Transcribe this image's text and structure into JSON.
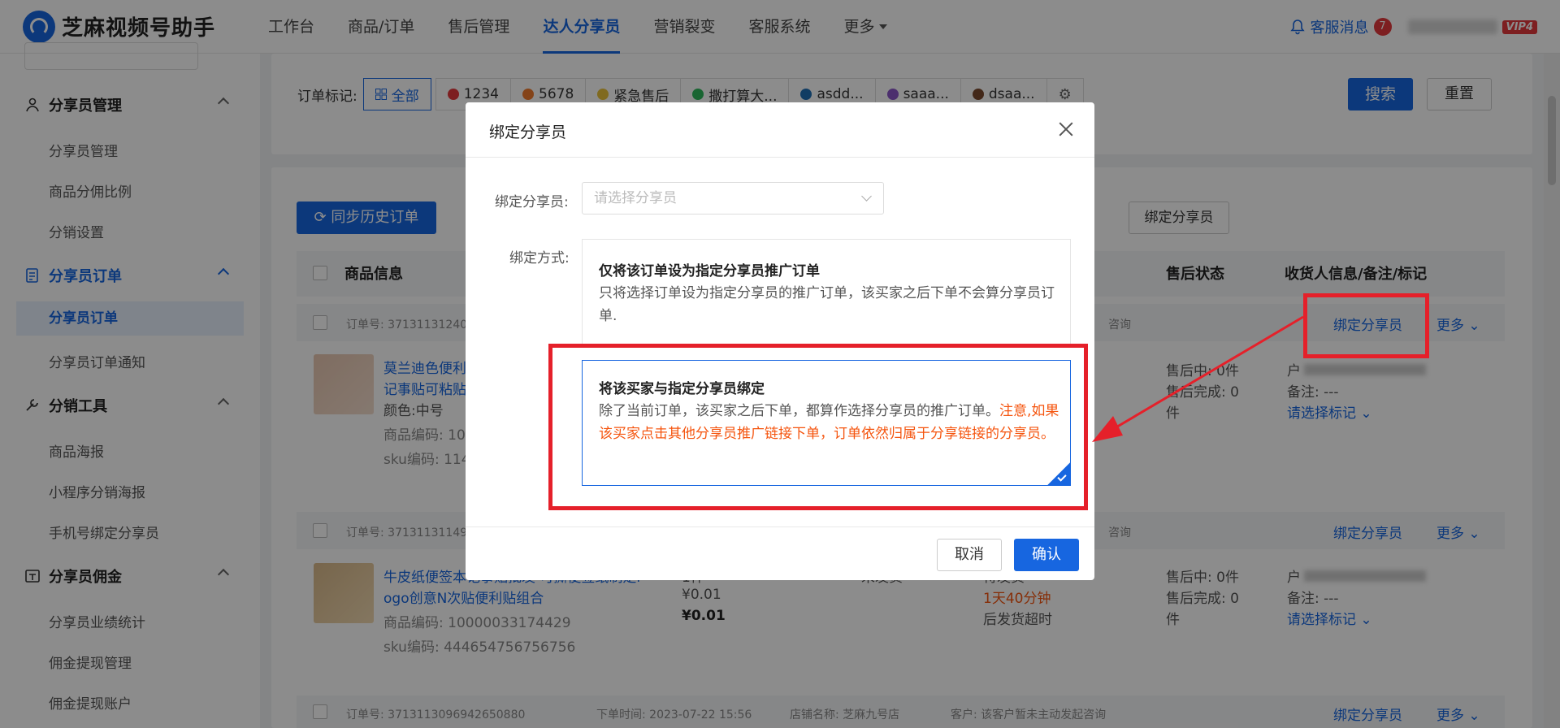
{
  "app": {
    "name": "芝麻视频号助手"
  },
  "nav": {
    "items": [
      "工作台",
      "商品/订单",
      "售后管理",
      "达人分享员",
      "营销裂变",
      "客服系统",
      "更多"
    ],
    "active_index": 3
  },
  "top_right": {
    "service_label": "客服消息",
    "unread_count": "7",
    "vip_label": "VIP4"
  },
  "sidebar": {
    "groups": [
      {
        "label": "分享员管理",
        "items": [
          "分享员管理",
          "商品分佣比例",
          "分销设置"
        ]
      },
      {
        "label": "分享员订单",
        "items": [
          "分享员订单",
          "分享员订单通知"
        ]
      },
      {
        "label": "分销工具",
        "items": [
          "商品海报",
          "小程序分销海报",
          "手机号绑定分享员"
        ]
      },
      {
        "label": "分享员佣金",
        "items": [
          "分享员业绩统计",
          "佣金提现管理",
          "佣金提现账户"
        ]
      }
    ],
    "active_item": "分享员订单"
  },
  "filters": {
    "tag_label": "订单标记:",
    "tags": [
      {
        "label": "全部",
        "color": ""
      },
      {
        "label": "1234",
        "color": "#e4393c"
      },
      {
        "label": "5678",
        "color": "#f07a2c"
      },
      {
        "label": "紧急售后",
        "color": "#e9c23b"
      },
      {
        "label": "撒打算大...",
        "color": "#2eb85c"
      },
      {
        "label": "asdd...",
        "color": "#1f6fb5"
      },
      {
        "label": "saaa...",
        "color": "#8a56c9"
      },
      {
        "label": "dsaa...",
        "color": "#7a4a2e"
      }
    ],
    "search_label": "搜索",
    "reset_label": "重置"
  },
  "toolbar": {
    "sync_label": "同步历史订单",
    "bind_label": "绑定分享员"
  },
  "table": {
    "headers": [
      "商品信息",
      "售后状态",
      "收货人信息/备注/标记"
    ],
    "orders": [
      {
        "order_no": "订单号: 37131131240",
        "product_title_1": "莫兰迪色便利",
        "product_title_2": "记事贴可粘贴",
        "spec": "颜色:中号",
        "product_code": "商品编码: 10",
        "sku_code": "sku编码: 114",
        "after_sale_1": "售后中: 0件",
        "after_sale_2": "售后完成: 0",
        "after_sale_3": "件",
        "receiver": "户",
        "remark": "备注: ---",
        "mark_link": "请选择标记",
        "bind_link": "绑定分享员",
        "more_link": "更多",
        "consult": "咨询"
      },
      {
        "order_no": "订单号: 37131131149",
        "product_title_1": "牛皮纸便签本记事贴批发 可撕便签纸制定l",
        "product_title_2": "ogo创意N次贴便利贴组合",
        "product_code": "商品编码: 10000033174429",
        "sku_code": "sku编码: 444654756756756",
        "qty": "1件",
        "price": "¥0.01",
        "paid": "¥0.01",
        "ship_status": "未发货",
        "deliver_status": "待发货",
        "deliver_time": "1天40分钟",
        "deliver_note": "后发货超时",
        "after_sale_1": "售后中: 0件",
        "after_sale_2": "售后完成: 0",
        "after_sale_3": "件",
        "receiver": "户",
        "remark": "备注: ---",
        "mark_link": "请选择标记",
        "bind_link": "绑定分享员",
        "more_link": "更多",
        "consult": "咨询"
      },
      {
        "order_no": "订单号: 3713113096942650880",
        "order_time": "下单时间: 2023-07-22 15:56",
        "shop": "店铺名称: 芝麻九号店",
        "customer": "客户: 该客户暂未主动发起咨询",
        "bind_link": "绑定分享员",
        "more_link": "更多"
      }
    ]
  },
  "modal": {
    "title": "绑定分享员",
    "bind_label": "绑定分享员:",
    "bind_placeholder": "请选择分享员",
    "method_label": "绑定方式:",
    "option1_title": "仅将该订单设为指定分享员推广订单",
    "option1_desc": "只将选择订单设为指定分享员的推广订单，该买家之后下单不会算分享员订单.",
    "option2_title": "将该买家与指定分享员绑定",
    "option2_desc": "除了当前订单，该买家之后下单，都算作选择分享员的推广订单。",
    "option2_warn": "注意,如果该买家点击其他分享员推广链接下单，订单依然归属于分享链接的分享员。",
    "cancel_label": "取消",
    "confirm_label": "确认",
    "selected_option": 2
  },
  "colors": {
    "primary": "#1766e0",
    "warning": "#f5550f",
    "annotation": "#e5202a"
  }
}
